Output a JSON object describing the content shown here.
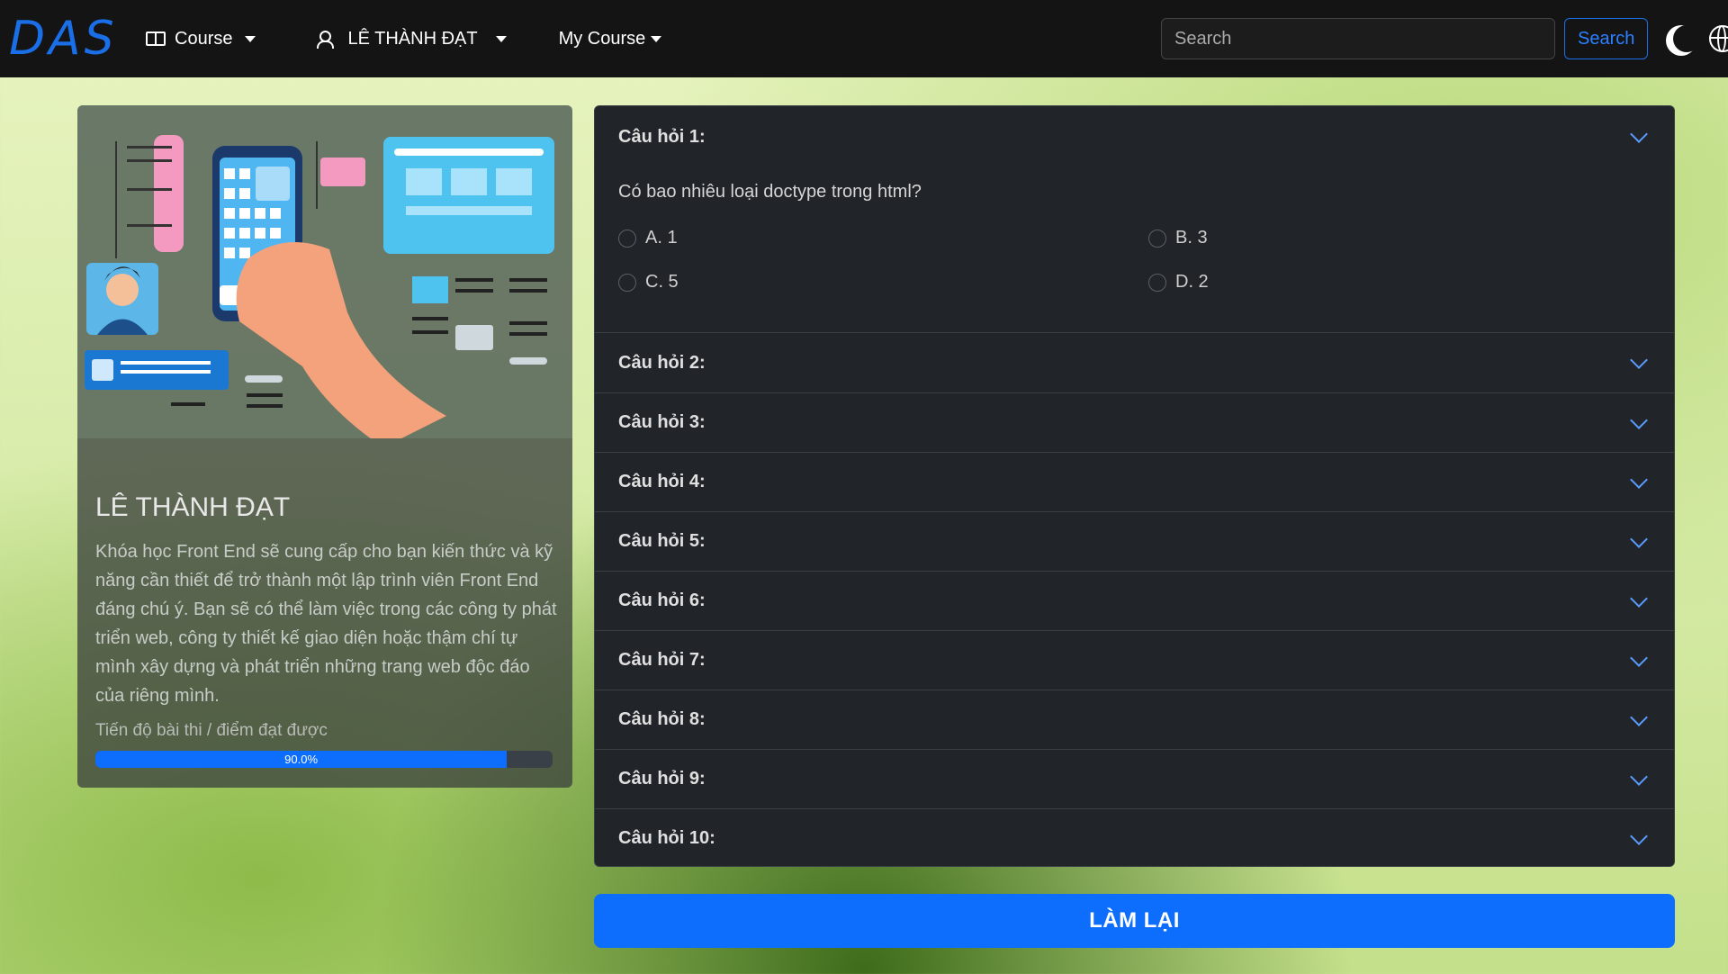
{
  "navbar": {
    "brand": "DAS",
    "course_label": "Course",
    "user_label": "LÊ THÀNH ĐẠT",
    "my_course_label": "My Course",
    "search_placeholder": "Search",
    "search_button": "Search"
  },
  "course": {
    "title": "LÊ THÀNH ĐẠT",
    "description": "Khóa học Front End sẽ cung cấp cho bạn kiến thức và kỹ năng cần thiết để trở thành một lập trình viên Front End đáng chú ý. Bạn sẽ có thể làm việc trong các công ty phát triển web, công ty thiết kế giao diện hoặc thậm chí tự mình xây dựng và phát triển những trang web độc đáo của riêng mình.",
    "progress_label": "Tiến độ bài thi / điểm đạt được",
    "progress_text": "90.0%",
    "progress_value": 0.9
  },
  "quiz": {
    "questions": [
      {
        "label": "Câu hỏi 1:",
        "text": "Có bao nhiêu loại doctype trong html?",
        "options": [
          "A. 1",
          "B. 3",
          "C. 5",
          "D. 2"
        ]
      },
      {
        "label": "Câu hỏi 2:"
      },
      {
        "label": "Câu hỏi 3:"
      },
      {
        "label": "Câu hỏi 4:"
      },
      {
        "label": "Câu hỏi 5:"
      },
      {
        "label": "Câu hỏi 6:"
      },
      {
        "label": "Câu hỏi 7:"
      },
      {
        "label": "Câu hỏi 8:"
      },
      {
        "label": "Câu hỏi 9:"
      },
      {
        "label": "Câu hỏi 10:"
      }
    ],
    "retry_button": "LÀM LẠI"
  },
  "colors": {
    "accent": "#0d6efd",
    "navbar_bg": "#141414",
    "panel_bg": "#212529"
  }
}
